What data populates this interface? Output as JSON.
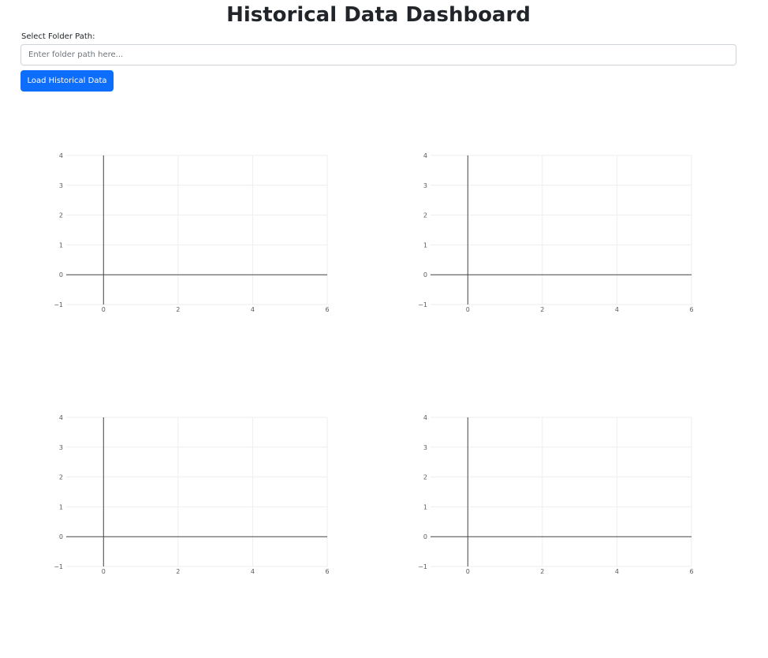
{
  "header": {
    "title": "Historical Data Dashboard"
  },
  "folder": {
    "label": "Select Folder Path:",
    "value": "",
    "placeholder": "Enter folder path here..."
  },
  "actions": {
    "load_label": "Load Historical Data"
  },
  "colors": {
    "primary": "#0d6efd",
    "grid": "#eeeeee",
    "axis": "#444444",
    "tick_text": "#5a5a5a"
  },
  "chart_data": [
    {
      "type": "line",
      "series": [],
      "xlim": [
        -1,
        6
      ],
      "ylim": [
        -1,
        4
      ],
      "x_ticks": [
        0,
        2,
        4,
        6
      ],
      "y_ticks": [
        -1,
        0,
        1,
        2,
        3,
        4
      ],
      "x_tick_labels": [
        "0",
        "2",
        "4",
        "6"
      ],
      "y_tick_labels": [
        "−1",
        "0",
        "1",
        "2",
        "3",
        "4"
      ],
      "grid": true,
      "zero_lines": true
    },
    {
      "type": "line",
      "series": [],
      "xlim": [
        -1,
        6
      ],
      "ylim": [
        -1,
        4
      ],
      "x_ticks": [
        0,
        2,
        4,
        6
      ],
      "y_ticks": [
        -1,
        0,
        1,
        2,
        3,
        4
      ],
      "x_tick_labels": [
        "0",
        "2",
        "4",
        "6"
      ],
      "y_tick_labels": [
        "−1",
        "0",
        "1",
        "2",
        "3",
        "4"
      ],
      "grid": true,
      "zero_lines": true
    },
    {
      "type": "line",
      "series": [],
      "xlim": [
        -1,
        6
      ],
      "ylim": [
        -1,
        4
      ],
      "x_ticks": [
        0,
        2,
        4,
        6
      ],
      "y_ticks": [
        -1,
        0,
        1,
        2,
        3,
        4
      ],
      "x_tick_labels": [
        "0",
        "2",
        "4",
        "6"
      ],
      "y_tick_labels": [
        "−1",
        "0",
        "1",
        "2",
        "3",
        "4"
      ],
      "grid": true,
      "zero_lines": true
    },
    {
      "type": "line",
      "series": [],
      "xlim": [
        -1,
        6
      ],
      "ylim": [
        -1,
        4
      ],
      "x_ticks": [
        0,
        2,
        4,
        6
      ],
      "y_ticks": [
        -1,
        0,
        1,
        2,
        3,
        4
      ],
      "x_tick_labels": [
        "0",
        "2",
        "4",
        "6"
      ],
      "y_tick_labels": [
        "−1",
        "0",
        "1",
        "2",
        "3",
        "4"
      ],
      "grid": true,
      "zero_lines": true
    }
  ]
}
